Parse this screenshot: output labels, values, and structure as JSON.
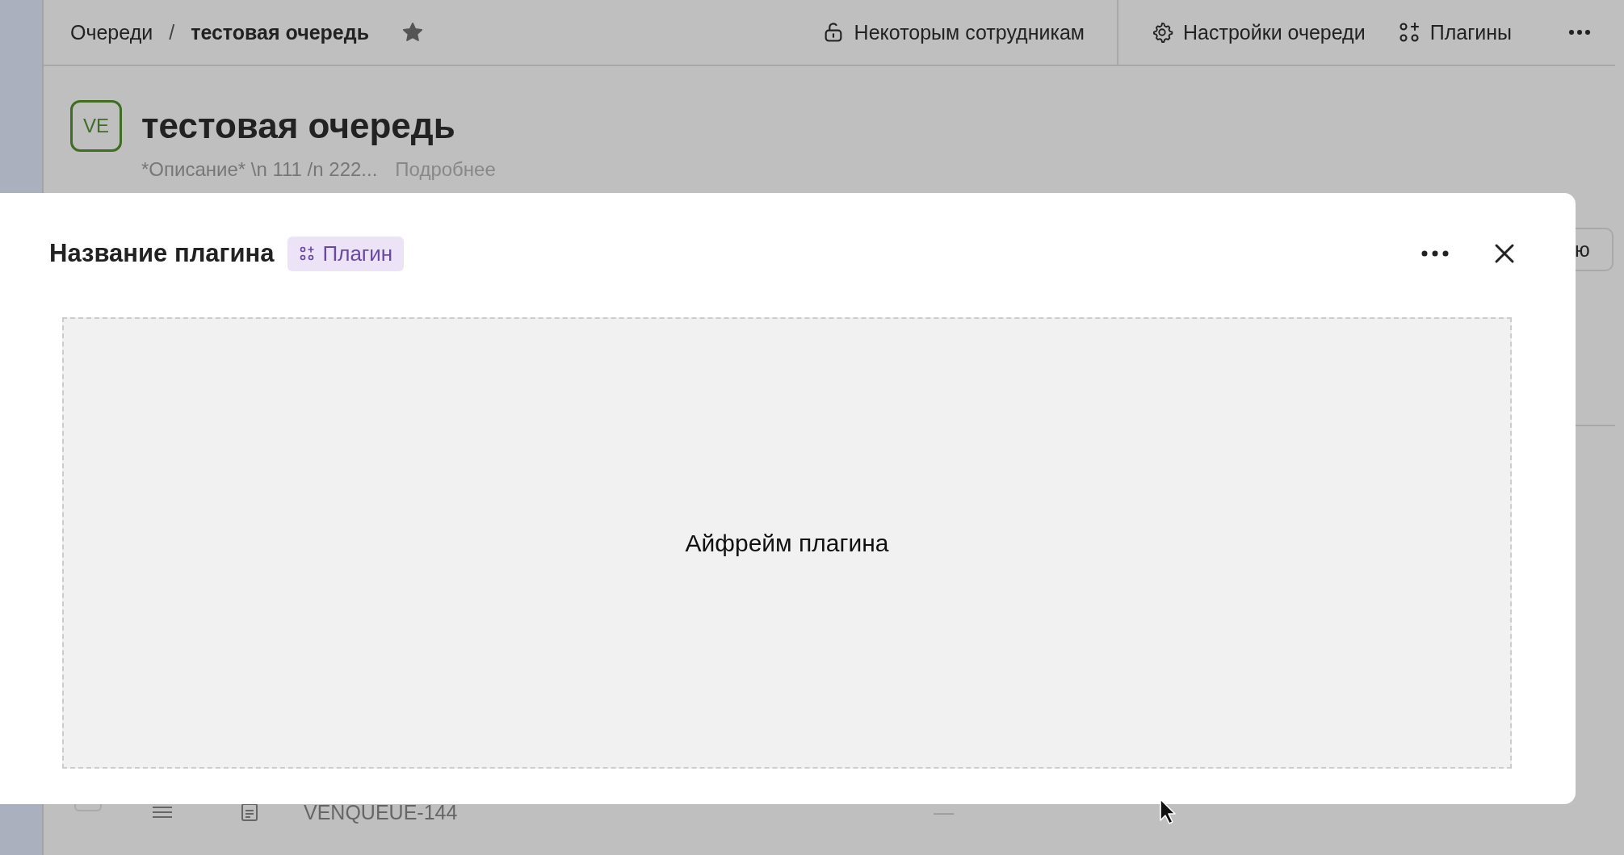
{
  "breadcrumbs": [
    {
      "label": "Очереди"
    },
    {
      "label": "тестовая очередь"
    }
  ],
  "breadcrumb_separator": "/",
  "favorite": true,
  "toolbar": [
    {
      "kind": "access",
      "label": "Некоторым сотрудникам"
    },
    {
      "kind": "settings",
      "label": "Настройки очереди"
    },
    {
      "kind": "plugins",
      "label": "Плагины"
    },
    {
      "kind": "more"
    }
  ],
  "queue": {
    "avatar": "VE",
    "title": "тестовая очередь",
    "description": "*Описание* \\n 111 /n 222...",
    "more_link": "Подробнее"
  },
  "background_button": {
    "label": "ю"
  },
  "row": {
    "checked": false,
    "key": "VENQUEUE-144",
    "value": "—"
  },
  "modal": {
    "title": "Название плагина",
    "tag": "Плагин",
    "iframe_text": "Айфрейм плагина"
  }
}
